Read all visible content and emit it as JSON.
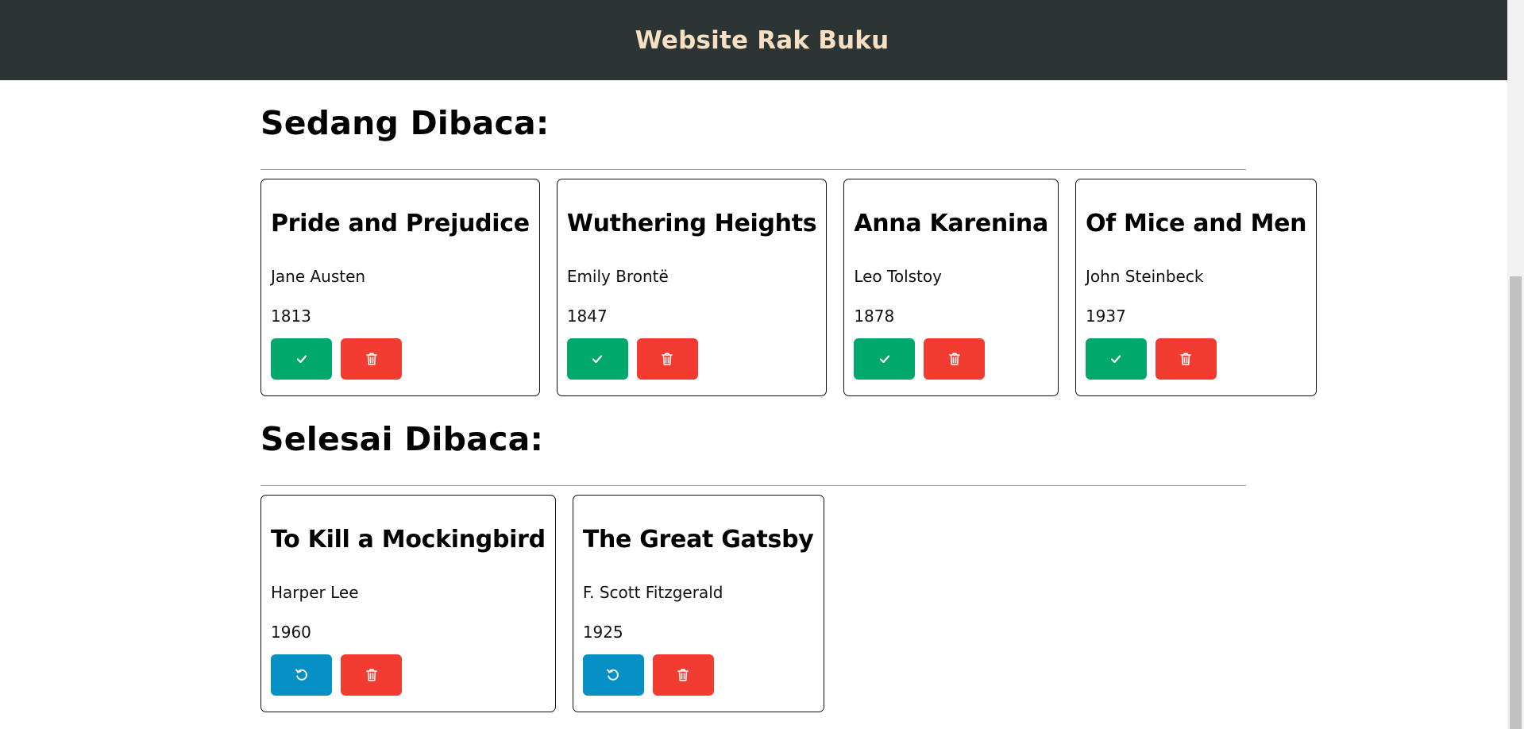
{
  "header": {
    "title": "Website Rak Buku"
  },
  "sections": {
    "reading": {
      "title": "Sedang Dibaca:",
      "books": [
        {
          "title": "Pride and Prejudice",
          "author": "Jane Austen",
          "year": "1813"
        },
        {
          "title": "Wuthering Heights",
          "author": "Emily Brontë",
          "year": "1847"
        },
        {
          "title": "Anna Karenina",
          "author": "Leo Tolstoy",
          "year": "1878"
        },
        {
          "title": "Of Mice and Men",
          "author": "John Steinbeck",
          "year": "1937"
        }
      ]
    },
    "finished": {
      "title": "Selesai Dibaca:",
      "books": [
        {
          "title": "To Kill a Mockingbird",
          "author": "Harper Lee",
          "year": "1960"
        },
        {
          "title": "The Great Gatsby",
          "author": "F. Scott Fitzgerald",
          "year": "1925"
        }
      ]
    }
  },
  "icons": {
    "finish": "check-icon",
    "undo": "undo-icon",
    "delete": "trash-icon"
  },
  "colors": {
    "header_bg": "#2d3534",
    "header_text": "#f6dfc3",
    "finish_button": "#01a86b",
    "undo_button": "#0690c4",
    "delete_button": "#f23c32"
  }
}
